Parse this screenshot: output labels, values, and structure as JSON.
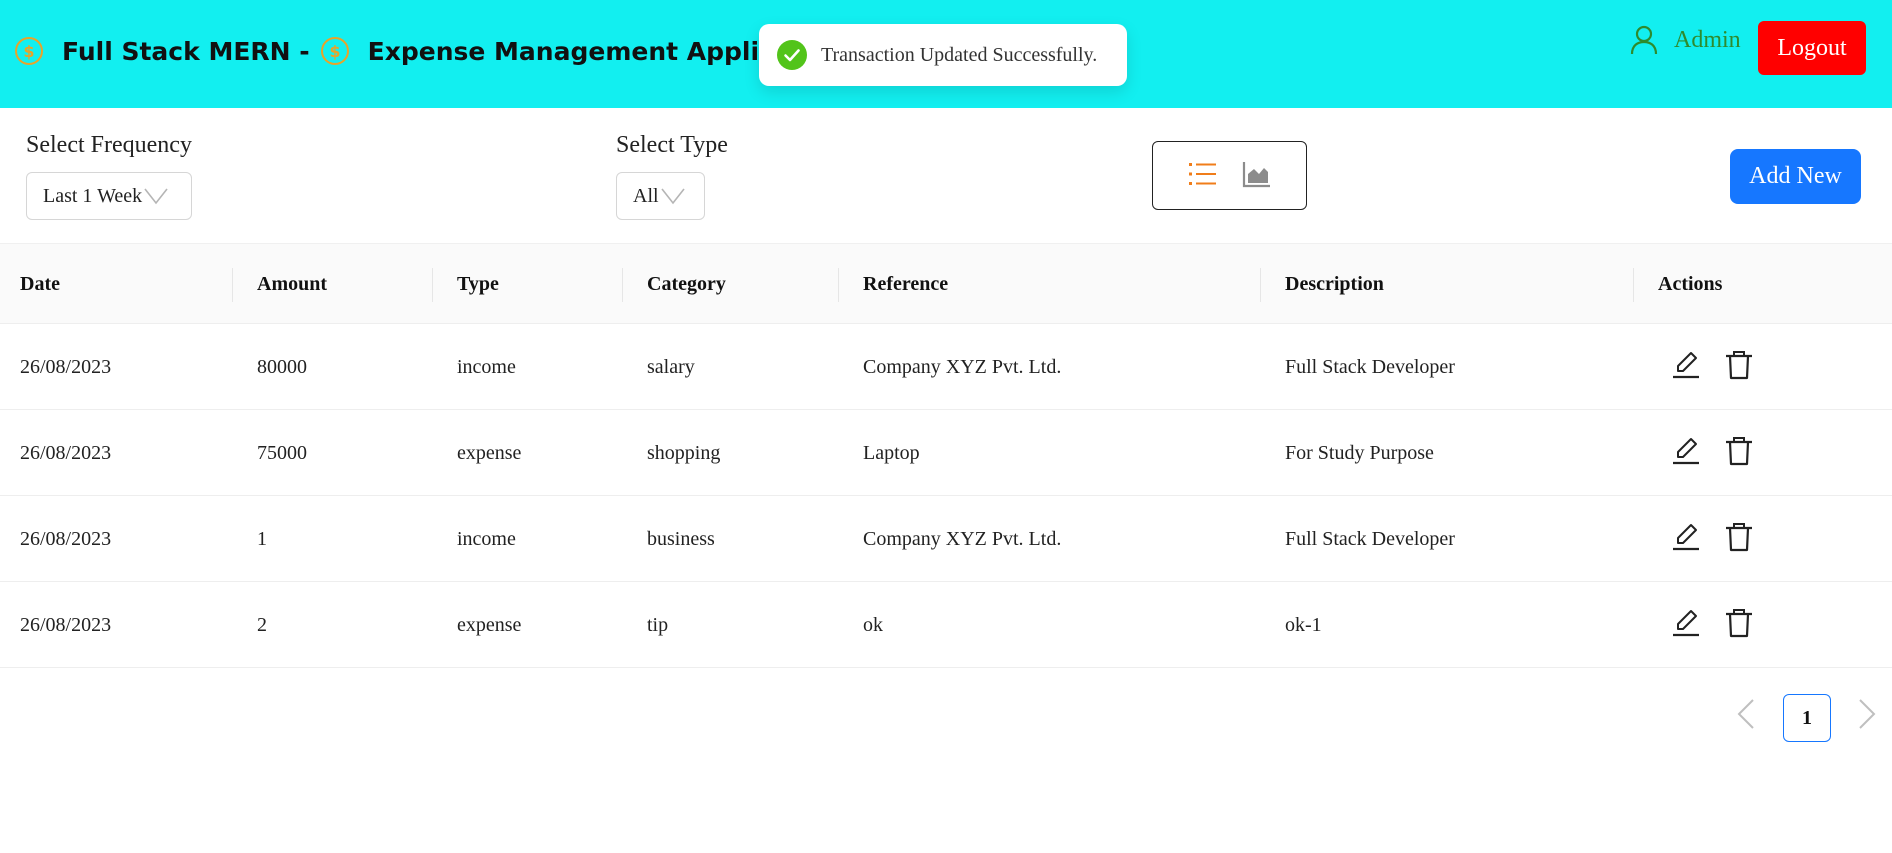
{
  "header": {
    "title_part1": "Full Stack MERN -",
    "title_part2": "Expense Management Application",
    "logo_icon": "dollar-coin-icon",
    "user_icon": "user-icon",
    "user_name": "Admin",
    "logout_label": "Logout",
    "bg_color": "#12eff0",
    "logout_color": "#ff0000"
  },
  "toast": {
    "icon": "check-circle-icon",
    "message": "Transaction Updated Successfully.",
    "icon_color": "#52c41a"
  },
  "filters": {
    "frequency_label": "Select Frequency",
    "frequency_value": "Last 1 Week",
    "type_label": "Select Type",
    "type_value": "All"
  },
  "view_toggle": {
    "list_icon": "list-icon",
    "chart_icon": "area-chart-icon",
    "active": "list",
    "active_color": "#f07d1a"
  },
  "add_new_label": "Add New",
  "table": {
    "columns": [
      "Date",
      "Amount",
      "Type",
      "Category",
      "Reference",
      "Description",
      "Actions"
    ],
    "rows": [
      {
        "date": "26/08/2023",
        "amount": "80000",
        "type": "income",
        "category": "salary",
        "reference": "Company XYZ Pvt. Ltd.",
        "description": "Full Stack Developer"
      },
      {
        "date": "26/08/2023",
        "amount": "75000",
        "type": "expense",
        "category": "shopping",
        "reference": "Laptop",
        "description": "For Study Purpose"
      },
      {
        "date": "26/08/2023",
        "amount": "1",
        "type": "income",
        "category": "business",
        "reference": "Company XYZ Pvt. Ltd.",
        "description": "Full Stack Developer"
      },
      {
        "date": "26/08/2023",
        "amount": "2",
        "type": "expense",
        "category": "tip",
        "reference": "ok",
        "description": "ok-1"
      }
    ],
    "row_actions": [
      "edit-icon",
      "delete-icon"
    ]
  },
  "pagination": {
    "current_page": "1",
    "prev_icon": "chevron-left-icon",
    "next_icon": "chevron-right-icon"
  }
}
